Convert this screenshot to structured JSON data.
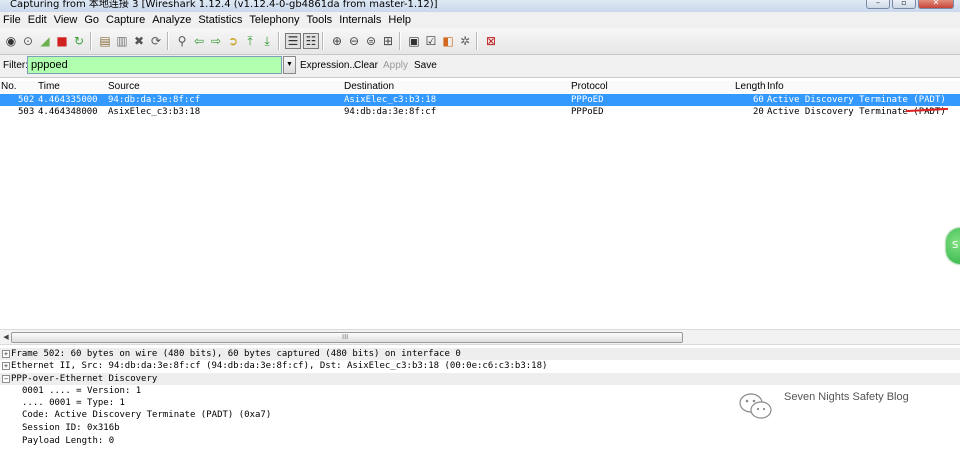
{
  "window": {
    "title": "Capturing from 本地连接 3   [Wireshark 1.12.4  (v1.12.4-0-gb4861da from master-1.12)]",
    "buttons": [
      "minimize",
      "maximize",
      "close"
    ]
  },
  "menu": {
    "items": [
      "File",
      "Edit",
      "View",
      "Go",
      "Capture",
      "Analyze",
      "Statistics",
      "Telephony",
      "Tools",
      "Internals",
      "Help"
    ]
  },
  "toolbar": {
    "icons": [
      "interfaces-icon",
      "options-icon",
      "start-capture-icon",
      "stop-capture-icon",
      "restart-capture-icon",
      "open-file-icon",
      "save-file-icon",
      "close-file-icon",
      "reload-icon",
      "find-packet-icon",
      "go-back-icon",
      "go-forward-icon",
      "go-to-packet-icon",
      "go-first-icon",
      "go-last-icon",
      "colorize-icon",
      "autoscroll-icon",
      "zoom-in-icon",
      "zoom-out-icon",
      "normal-size-icon",
      "resize-columns-icon",
      "capture-filters-icon",
      "display-filters-icon",
      "coloring-rules-icon",
      "preferences-icon",
      "help-icon"
    ]
  },
  "filter": {
    "label": "Filter:",
    "value": "pppoed",
    "background": "#afffaf",
    "buttons": {
      "expression": "Expression...",
      "clear": "Clear",
      "apply": "Apply",
      "save": "Save"
    }
  },
  "packet_list": {
    "columns": {
      "no": "No.",
      "time": "Time",
      "source": "Source",
      "destination": "Destination",
      "protocol": "Protocol",
      "length": "Length",
      "info": "Info"
    },
    "rows": [
      {
        "no": "502",
        "time": "4.464335000",
        "source": "94:db:da:3e:8f:cf",
        "destination": "AsixElec_c3:b3:18",
        "protocol": "PPPoED",
        "length": "60",
        "info": "Active Discovery Terminate (PADT)",
        "selected": true
      },
      {
        "no": "503",
        "time": "4.464348000",
        "source": "AsixElec_c3:b3:18",
        "destination": "94:db:da:3e:8f:cf",
        "protocol": "PPPoED",
        "length": "20",
        "info": "Active Discovery Terminate (PADT)",
        "selected": false
      }
    ],
    "selection_color": "#3399ff",
    "scroll_grip": "III"
  },
  "details": {
    "tree": [
      {
        "label": "Frame 502: 60 bytes on wire (480 bits), 60 bytes captured (480 bits) on interface 0",
        "expanded": false
      },
      {
        "label": "Ethernet II, Src: 94:db:da:3e:8f:cf (94:db:da:3e:8f:cf), Dst: AsixElec_c3:b3:18 (00:0e:c6:c3:b3:18)",
        "expanded": false
      },
      {
        "label": "PPP-over-Ethernet Discovery",
        "expanded": true,
        "children": [
          "0001 .... = Version: 1",
          ".... 0001 = Type: 1",
          "Code: Active Discovery Terminate (PADT) (0xa7)",
          "Session ID: 0x316b",
          "Payload Length: 0"
        ]
      }
    ]
  },
  "watermark": {
    "text": "Seven Nights Safety Blog"
  }
}
